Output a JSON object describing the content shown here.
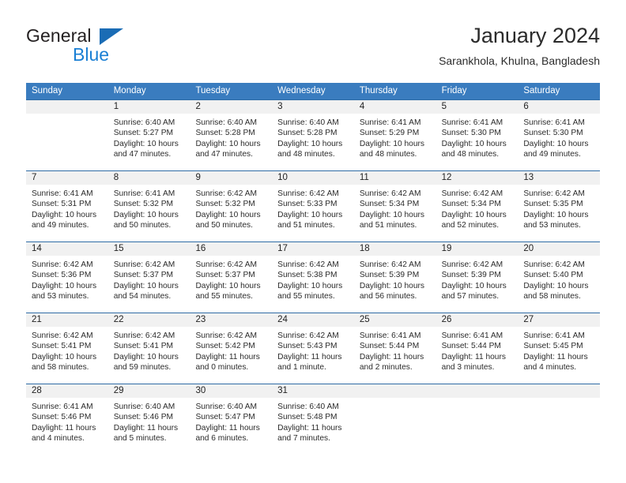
{
  "brand": {
    "name_dark": "General",
    "name_blue": "Blue",
    "accent_blue": "#1a7fd4",
    "logo_triangle_color": "#1a6cb5"
  },
  "header": {
    "title": "January 2024",
    "subtitle": "Sarankhola, Khulna, Bangladesh"
  },
  "calendar": {
    "header_bg": "#3a7cbf",
    "daynum_band_bg": "#f1f1f1",
    "weekdays": [
      "Sunday",
      "Monday",
      "Tuesday",
      "Wednesday",
      "Thursday",
      "Friday",
      "Saturday"
    ],
    "weeks": [
      [
        {
          "day": "",
          "sunrise": "",
          "sunset": "",
          "daylight_1": "",
          "daylight_2": ""
        },
        {
          "day": "1",
          "sunrise": "Sunrise: 6:40 AM",
          "sunset": "Sunset: 5:27 PM",
          "daylight_1": "Daylight: 10 hours",
          "daylight_2": "and 47 minutes."
        },
        {
          "day": "2",
          "sunrise": "Sunrise: 6:40 AM",
          "sunset": "Sunset: 5:28 PM",
          "daylight_1": "Daylight: 10 hours",
          "daylight_2": "and 47 minutes."
        },
        {
          "day": "3",
          "sunrise": "Sunrise: 6:40 AM",
          "sunset": "Sunset: 5:28 PM",
          "daylight_1": "Daylight: 10 hours",
          "daylight_2": "and 48 minutes."
        },
        {
          "day": "4",
          "sunrise": "Sunrise: 6:41 AM",
          "sunset": "Sunset: 5:29 PM",
          "daylight_1": "Daylight: 10 hours",
          "daylight_2": "and 48 minutes."
        },
        {
          "day": "5",
          "sunrise": "Sunrise: 6:41 AM",
          "sunset": "Sunset: 5:30 PM",
          "daylight_1": "Daylight: 10 hours",
          "daylight_2": "and 48 minutes."
        },
        {
          "day": "6",
          "sunrise": "Sunrise: 6:41 AM",
          "sunset": "Sunset: 5:30 PM",
          "daylight_1": "Daylight: 10 hours",
          "daylight_2": "and 49 minutes."
        }
      ],
      [
        {
          "day": "7",
          "sunrise": "Sunrise: 6:41 AM",
          "sunset": "Sunset: 5:31 PM",
          "daylight_1": "Daylight: 10 hours",
          "daylight_2": "and 49 minutes."
        },
        {
          "day": "8",
          "sunrise": "Sunrise: 6:41 AM",
          "sunset": "Sunset: 5:32 PM",
          "daylight_1": "Daylight: 10 hours",
          "daylight_2": "and 50 minutes."
        },
        {
          "day": "9",
          "sunrise": "Sunrise: 6:42 AM",
          "sunset": "Sunset: 5:32 PM",
          "daylight_1": "Daylight: 10 hours",
          "daylight_2": "and 50 minutes."
        },
        {
          "day": "10",
          "sunrise": "Sunrise: 6:42 AM",
          "sunset": "Sunset: 5:33 PM",
          "daylight_1": "Daylight: 10 hours",
          "daylight_2": "and 51 minutes."
        },
        {
          "day": "11",
          "sunrise": "Sunrise: 6:42 AM",
          "sunset": "Sunset: 5:34 PM",
          "daylight_1": "Daylight: 10 hours",
          "daylight_2": "and 51 minutes."
        },
        {
          "day": "12",
          "sunrise": "Sunrise: 6:42 AM",
          "sunset": "Sunset: 5:34 PM",
          "daylight_1": "Daylight: 10 hours",
          "daylight_2": "and 52 minutes."
        },
        {
          "day": "13",
          "sunrise": "Sunrise: 6:42 AM",
          "sunset": "Sunset: 5:35 PM",
          "daylight_1": "Daylight: 10 hours",
          "daylight_2": "and 53 minutes."
        }
      ],
      [
        {
          "day": "14",
          "sunrise": "Sunrise: 6:42 AM",
          "sunset": "Sunset: 5:36 PM",
          "daylight_1": "Daylight: 10 hours",
          "daylight_2": "and 53 minutes."
        },
        {
          "day": "15",
          "sunrise": "Sunrise: 6:42 AM",
          "sunset": "Sunset: 5:37 PM",
          "daylight_1": "Daylight: 10 hours",
          "daylight_2": "and 54 minutes."
        },
        {
          "day": "16",
          "sunrise": "Sunrise: 6:42 AM",
          "sunset": "Sunset: 5:37 PM",
          "daylight_1": "Daylight: 10 hours",
          "daylight_2": "and 55 minutes."
        },
        {
          "day": "17",
          "sunrise": "Sunrise: 6:42 AM",
          "sunset": "Sunset: 5:38 PM",
          "daylight_1": "Daylight: 10 hours",
          "daylight_2": "and 55 minutes."
        },
        {
          "day": "18",
          "sunrise": "Sunrise: 6:42 AM",
          "sunset": "Sunset: 5:39 PM",
          "daylight_1": "Daylight: 10 hours",
          "daylight_2": "and 56 minutes."
        },
        {
          "day": "19",
          "sunrise": "Sunrise: 6:42 AM",
          "sunset": "Sunset: 5:39 PM",
          "daylight_1": "Daylight: 10 hours",
          "daylight_2": "and 57 minutes."
        },
        {
          "day": "20",
          "sunrise": "Sunrise: 6:42 AM",
          "sunset": "Sunset: 5:40 PM",
          "daylight_1": "Daylight: 10 hours",
          "daylight_2": "and 58 minutes."
        }
      ],
      [
        {
          "day": "21",
          "sunrise": "Sunrise: 6:42 AM",
          "sunset": "Sunset: 5:41 PM",
          "daylight_1": "Daylight: 10 hours",
          "daylight_2": "and 58 minutes."
        },
        {
          "day": "22",
          "sunrise": "Sunrise: 6:42 AM",
          "sunset": "Sunset: 5:41 PM",
          "daylight_1": "Daylight: 10 hours",
          "daylight_2": "and 59 minutes."
        },
        {
          "day": "23",
          "sunrise": "Sunrise: 6:42 AM",
          "sunset": "Sunset: 5:42 PM",
          "daylight_1": "Daylight: 11 hours",
          "daylight_2": "and 0 minutes."
        },
        {
          "day": "24",
          "sunrise": "Sunrise: 6:42 AM",
          "sunset": "Sunset: 5:43 PM",
          "daylight_1": "Daylight: 11 hours",
          "daylight_2": "and 1 minute."
        },
        {
          "day": "25",
          "sunrise": "Sunrise: 6:41 AM",
          "sunset": "Sunset: 5:44 PM",
          "daylight_1": "Daylight: 11 hours",
          "daylight_2": "and 2 minutes."
        },
        {
          "day": "26",
          "sunrise": "Sunrise: 6:41 AM",
          "sunset": "Sunset: 5:44 PM",
          "daylight_1": "Daylight: 11 hours",
          "daylight_2": "and 3 minutes."
        },
        {
          "day": "27",
          "sunrise": "Sunrise: 6:41 AM",
          "sunset": "Sunset: 5:45 PM",
          "daylight_1": "Daylight: 11 hours",
          "daylight_2": "and 4 minutes."
        }
      ],
      [
        {
          "day": "28",
          "sunrise": "Sunrise: 6:41 AM",
          "sunset": "Sunset: 5:46 PM",
          "daylight_1": "Daylight: 11 hours",
          "daylight_2": "and 4 minutes."
        },
        {
          "day": "29",
          "sunrise": "Sunrise: 6:40 AM",
          "sunset": "Sunset: 5:46 PM",
          "daylight_1": "Daylight: 11 hours",
          "daylight_2": "and 5 minutes."
        },
        {
          "day": "30",
          "sunrise": "Sunrise: 6:40 AM",
          "sunset": "Sunset: 5:47 PM",
          "daylight_1": "Daylight: 11 hours",
          "daylight_2": "and 6 minutes."
        },
        {
          "day": "31",
          "sunrise": "Sunrise: 6:40 AM",
          "sunset": "Sunset: 5:48 PM",
          "daylight_1": "Daylight: 11 hours",
          "daylight_2": "and 7 minutes."
        },
        {
          "day": "",
          "sunrise": "",
          "sunset": "",
          "daylight_1": "",
          "daylight_2": ""
        },
        {
          "day": "",
          "sunrise": "",
          "sunset": "",
          "daylight_1": "",
          "daylight_2": ""
        },
        {
          "day": "",
          "sunrise": "",
          "sunset": "",
          "daylight_1": "",
          "daylight_2": ""
        }
      ]
    ]
  }
}
